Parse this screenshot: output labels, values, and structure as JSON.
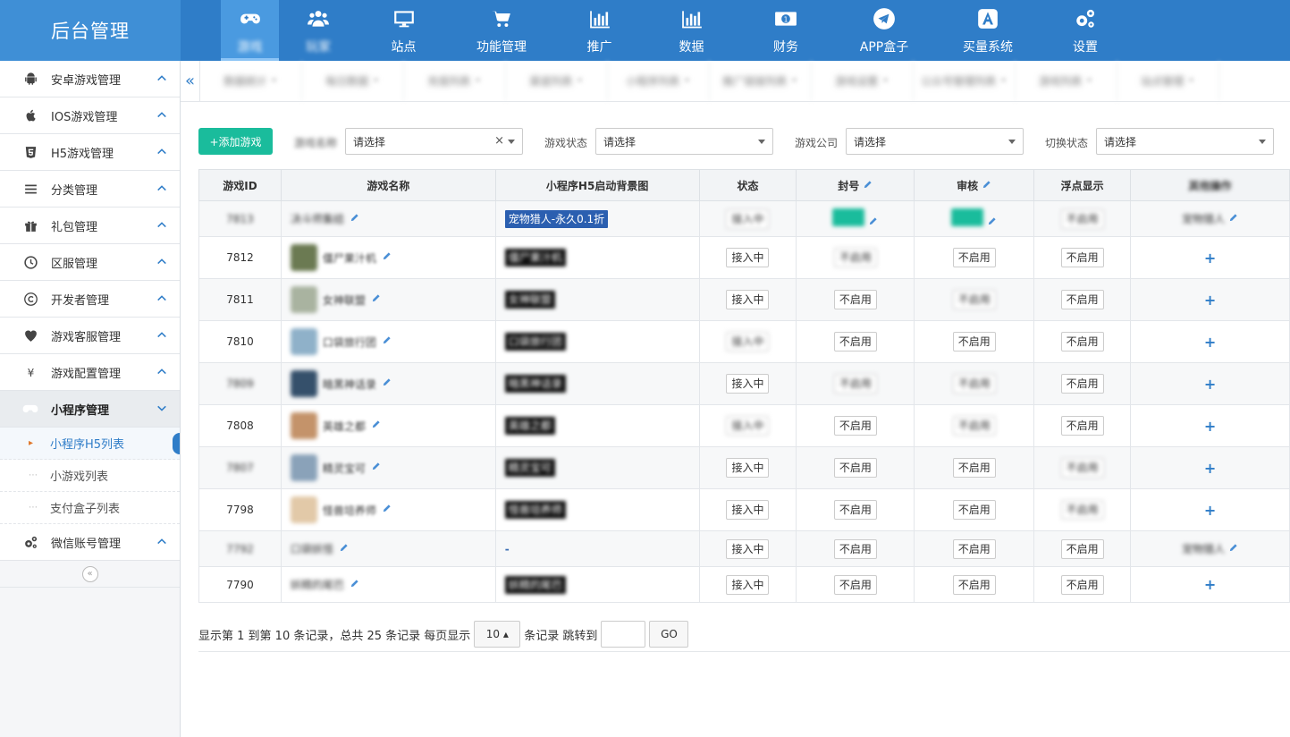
{
  "brand": "后台管理",
  "nav": [
    {
      "label": "游戏",
      "icon": "gamepad-icon",
      "active": true
    },
    {
      "label": "玩家",
      "icon": "users-icon"
    },
    {
      "label": "站点",
      "icon": "monitor-icon"
    },
    {
      "label": "功能管理",
      "icon": "cart-icon"
    },
    {
      "label": "推广",
      "icon": "bar-chart-icon"
    },
    {
      "label": "数据",
      "icon": "bar-chart-icon"
    },
    {
      "label": "财务",
      "icon": "money-icon"
    },
    {
      "label": "APP盒子",
      "icon": "paper-plane-icon"
    },
    {
      "label": "买量系统",
      "icon": "app-store-icon"
    },
    {
      "label": "设置",
      "icon": "gears-icon"
    }
  ],
  "sidebar": {
    "items": [
      {
        "label": "安卓游戏管理",
        "icon": "android-icon"
      },
      {
        "label": "IOS游戏管理",
        "icon": "apple-icon"
      },
      {
        "label": "H5游戏管理",
        "icon": "html5-icon"
      },
      {
        "label": "分类管理",
        "icon": "list-icon"
      },
      {
        "label": "礼包管理",
        "icon": "gift-icon"
      },
      {
        "label": "区服管理",
        "icon": "clock-icon"
      },
      {
        "label": "开发者管理",
        "icon": "copyright-icon"
      },
      {
        "label": "游戏客服管理",
        "icon": "heart-icon"
      },
      {
        "label": "游戏配置管理",
        "icon": "yen-icon"
      },
      {
        "label": "小程序管理",
        "icon": "gamepad-icon",
        "open": true
      },
      {
        "label": "微信账号管理",
        "icon": "gears-icon"
      }
    ],
    "subitems": [
      {
        "label": "小程序H5列表",
        "active": true
      },
      {
        "label": "小游戏列表"
      },
      {
        "label": "支付盒子列表"
      }
    ]
  },
  "tabs": [
    {
      "label": "数据统计"
    },
    {
      "label": "每日数据"
    },
    {
      "label": "充值列表"
    },
    {
      "label": "渠道列表"
    },
    {
      "label": "小程序列表"
    },
    {
      "label": "推广链接列表"
    },
    {
      "label": "游戏设置"
    },
    {
      "label": "公众号管理列表"
    },
    {
      "label": "游戏列表"
    },
    {
      "label": "站点管理"
    }
  ],
  "filters": {
    "add_button": "+添加游戏",
    "game_name_label": "游戏名称",
    "game_name_value": "请选择",
    "game_status_label": "游戏状态",
    "game_status_value": "请选择",
    "company_label": "游戏公司",
    "company_value": "请选择",
    "switch_label": "切换状态",
    "switch_value": "请选择"
  },
  "table": {
    "headers": [
      "游戏ID",
      "游戏名称",
      "小程序H5启动背景图",
      "状态",
      "封号",
      "审核",
      "浮点显示",
      "其他操作"
    ],
    "rows": [
      {
        "id": "7813",
        "name": "决斗师集结",
        "bg": "宠物猎人-永久0.1折",
        "bg_style": "blue",
        "status": "接入中",
        "ban": "teal",
        "review": "teal",
        "float": "不启用",
        "other": "宠物猎人",
        "thumb": ""
      },
      {
        "id": "7812",
        "name": "僵尸果汁机",
        "bg": "僵尸果汁机",
        "status": "接入中",
        "ban": "不启用",
        "review": "不启用",
        "float": "不启用",
        "other": "+",
        "thumb": "#6b7a52"
      },
      {
        "id": "7811",
        "name": "女神联盟",
        "bg": "女神联盟",
        "status": "接入中",
        "ban": "不启用",
        "review": "不启用",
        "float": "不启用",
        "other": "+",
        "thumb": "#a9b3a0"
      },
      {
        "id": "7810",
        "name": "口袋旅行团",
        "bg": "口袋旅行团",
        "status": "接入中",
        "ban": "不启用",
        "review": "不启用",
        "float": "不启用",
        "other": "+",
        "thumb": "#8fb1c9"
      },
      {
        "id": "7809",
        "name": "暗黑神话录",
        "bg": "暗黑神话录",
        "status": "接入中",
        "ban": "不启用",
        "review": "不启用",
        "float": "不启用",
        "other": "+",
        "thumb": "#35506b"
      },
      {
        "id": "7808",
        "name": "英雄之都",
        "bg": "英雄之都",
        "status": "接入中",
        "ban": "不启用",
        "review": "不启用",
        "float": "不启用",
        "other": "+",
        "thumb": "#c4936a"
      },
      {
        "id": "7807",
        "name": "精灵宝可",
        "bg": "精灵宝可",
        "status": "接入中",
        "ban": "不启用",
        "review": "不启用",
        "float": "不启用",
        "other": "+",
        "thumb": "#8aa2b9"
      },
      {
        "id": "7798",
        "name": "怪兽培养师",
        "bg": "怪兽培养师",
        "status": "接入中",
        "ban": "不启用",
        "review": "不启用",
        "float": "不启用",
        "other": "+",
        "thumb": "#e2c9a8"
      },
      {
        "id": "7792",
        "name": "口袋妖怪",
        "bg": "-",
        "bg_style": "dash",
        "status": "接入中",
        "ban": "不启用",
        "review": "不启用",
        "float": "不启用",
        "other": "宠物猎人",
        "thumb": ""
      },
      {
        "id": "7790",
        "name": "妖精的尾巴",
        "bg": "妖精的尾巴",
        "status": "接入中",
        "ban": "不启用",
        "review": "不启用",
        "float": "不启用",
        "other": "+",
        "thumb": ""
      }
    ]
  },
  "pager": {
    "summary": "显示第 1 到第 10 条记录，总共 25 条记录 每页显示",
    "page_size": "10 ▴",
    "suffix": "条记录 跳转到",
    "go": "GO"
  }
}
